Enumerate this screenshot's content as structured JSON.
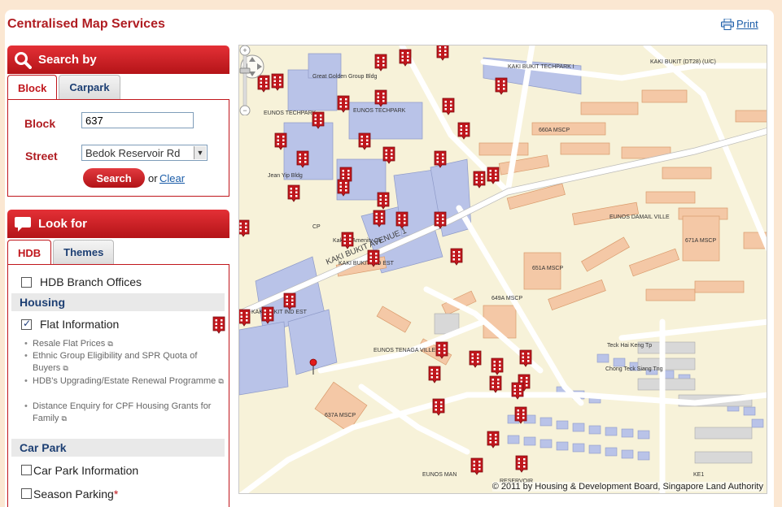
{
  "app": {
    "title": "Centralised Map Services",
    "print_label": "Print"
  },
  "search_panel": {
    "title": "Search by",
    "tabs": [
      "Block",
      "Carpark"
    ],
    "active_tab": "Block",
    "block_label": "Block",
    "block_value": "637",
    "street_label": "Street",
    "street_value": "Bedok Reservoir Rd",
    "search_button": "Search",
    "or_text": "or",
    "clear_link": "Clear"
  },
  "look_for_panel": {
    "title": "Look for",
    "tabs": [
      "HDB",
      "Themes"
    ],
    "active_tab": "HDB",
    "branch_offices": {
      "label": "HDB Branch Offices",
      "checked": false
    },
    "housing_section": "Housing",
    "flat_info": {
      "label": "Flat Information",
      "checked": true
    },
    "flat_subitems": [
      "Resale Flat Prices",
      "Ethnic Group Eligibility and SPR Quota of Buyers",
      "HDB's Upgrading/Estate Renewal Programme",
      "Distance Enquiry for CPF Housing Grants for Family"
    ],
    "car_park_section": "Car Park",
    "car_park_info": {
      "label": "Car Park Information",
      "checked": false
    },
    "season_parking": {
      "label": "Season Parking",
      "required_mark": "*",
      "checked": false
    }
  },
  "map": {
    "copyright": "© 2011 by Housing & Development Board, Singapore Land Authority",
    "labels": [
      {
        "text": "KAKI BUKIT AVENUE 1"
      },
      {
        "text": "EUNOS TECHPARK"
      },
      {
        "text": "EUNOS TECHPARK"
      },
      {
        "text": "KAKI BUKIT TECHPARK I"
      },
      {
        "text": "KAKI BUKIT (DT28) (U/C)"
      },
      {
        "text": "Great Golden Group Bldg"
      },
      {
        "text": "Jean Yip Bldg"
      },
      {
        "text": "Kaki Bt Amenity Ctr"
      },
      {
        "text": "KAKI BUKIT IND EST"
      },
      {
        "text": "KAKI BUKIT IND EST"
      },
      {
        "text": "EUNOS TENAGA VILLE"
      },
      {
        "text": "EUNOS DAMAIL VILLE"
      },
      {
        "text": "660A MSCP"
      },
      {
        "text": "651A MSCP"
      },
      {
        "text": "649A MSCP"
      },
      {
        "text": "671A MSCP"
      },
      {
        "text": "637A MSCP"
      },
      {
        "text": "Teck Hai Keng Tp"
      },
      {
        "text": "Chong Teck Siang Tng"
      },
      {
        "text": "RESERVOIR"
      },
      {
        "text": "EUNOS MAN"
      },
      {
        "text": "KE1"
      },
      {
        "text": "CP"
      }
    ],
    "marker_count": 62
  },
  "colors": {
    "brand_red": "#c0161c",
    "link_blue": "#1a5ca8",
    "map_land": "#f7f2d9",
    "map_road": "#ffffff",
    "hdb_block": "#f4c8a6",
    "industrial": "#b9c3e8",
    "cp_gray": "#cfcfcf"
  }
}
